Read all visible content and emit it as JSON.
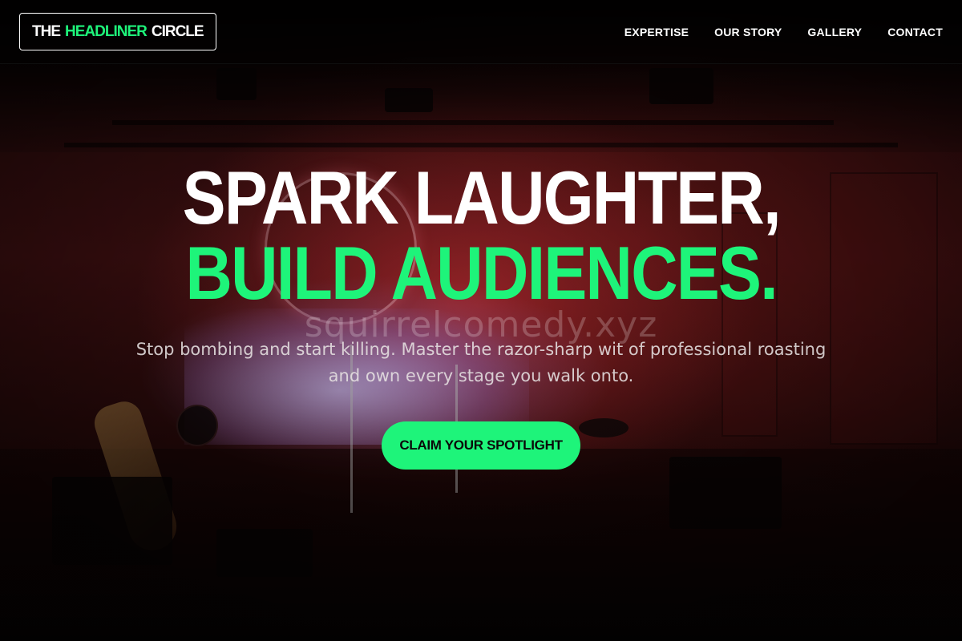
{
  "header": {
    "logo": {
      "part1": "THE",
      "part2": "HEADLINER",
      "part3": "CIRCLE"
    },
    "nav": [
      {
        "label": "EXPERTISE"
      },
      {
        "label": "OUR STORY"
      },
      {
        "label": "GALLERY"
      },
      {
        "label": "CONTACT"
      }
    ]
  },
  "hero": {
    "headline_line1": "SPARK LAUGHTER,",
    "headline_line2": "BUILD AUDIENCES.",
    "watermark": "squirrelcomedy.xyz",
    "subtitle": "Stop bombing and start killing. Master the razor-sharp wit of professional roasting and own every stage you walk onto.",
    "cta_label": "CLAIM YOUR SPOTLIGHT"
  },
  "colors": {
    "accent": "#1ef47a",
    "text": "#ffffff",
    "header_bg": "#000000"
  }
}
